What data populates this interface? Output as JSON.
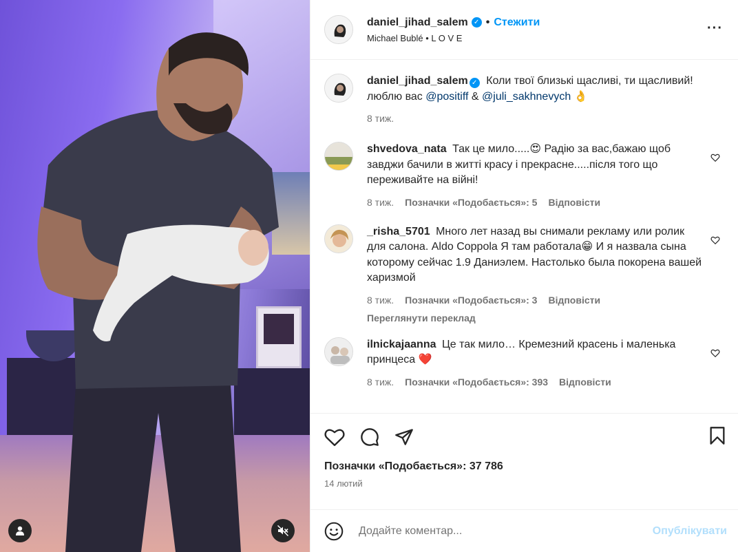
{
  "header": {
    "username": "daniel_jihad_salem",
    "follow_label": "Стежити",
    "audio": "Michael Bublé • L O V E",
    "more_icon": "more-horizontal-icon"
  },
  "caption": {
    "username": "daniel_jihad_salem",
    "text": "Коли твої близькі щасливі, ти щасливий! люблю вас",
    "mention1": "@positiff",
    "amp": "&",
    "mention2": "@juli_sakhnevych",
    "emoji": "👌",
    "time": "8 тиж."
  },
  "comments": [
    {
      "username": "shvedova_nata",
      "text": "Так це мило.....😍 Радію за вас,бажаю щоб завджи бачили в житті красу і прекрасне.....після того що переживайте на війні!",
      "time": "8 тиж.",
      "likes": "Позначки «Подобається»: 5",
      "reply": "Відповісти"
    },
    {
      "username": "_risha_5701",
      "text": "Много лет назад вы снимали рекламу или ролик для салона. Aldo Coppola Я там работала😁 И я назвала сына которому сейчас 1.9 Даниэлем. Настолько была покорена вашей харизмой",
      "time": "8 тиж.",
      "likes": "Позначки «Подобається»: 3",
      "reply": "Відповісти",
      "translate": "Переглянути переклад"
    },
    {
      "username": "ilnickajaanna",
      "text": "Це так мило… Кремезний красень і маленька принцеса ❤️",
      "time": "8 тиж.",
      "likes": "Позначки «Подобається»: 393",
      "reply": "Відповісти"
    }
  ],
  "footer": {
    "likes": "Позначки «Подобається»: 37 786",
    "date": "14 лютий"
  },
  "add_comment": {
    "placeholder": "Додайте коментар...",
    "publish": "Опублікувати"
  },
  "colors": {
    "accent": "#0095f6",
    "publish_disabled": "#b2dffc",
    "muted_text": "#737373",
    "mention": "#00376b"
  }
}
